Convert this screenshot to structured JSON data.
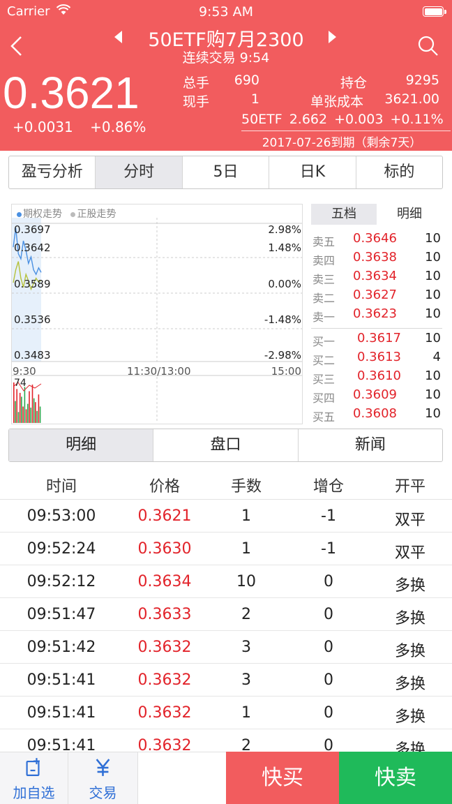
{
  "status": {
    "carrier": "Carrier",
    "time": "9:53 AM"
  },
  "header": {
    "title": "50ETF购7月2300",
    "subtitle": "连续交易 9:54",
    "price": "0.3621",
    "change": "+0.0031",
    "change_pct": "+0.86%",
    "stats": [
      {
        "label": "总手",
        "value": "690"
      },
      {
        "label": "现手",
        "value": "1"
      },
      {
        "label": "持仓",
        "value": "9295"
      },
      {
        "label": "单张成本",
        "value": "3621.00"
      }
    ],
    "etf": {
      "name": "50ETF",
      "price": "2.662",
      "change": "+0.003",
      "change_pct": "+0.11%"
    },
    "expiry": "2017-07-26到期（剩余7天）"
  },
  "tabs": [
    "盈亏分析",
    "分时",
    "5日",
    "日K",
    "标的"
  ],
  "active_tab": 1,
  "chart": {
    "legend_option": "期权走势",
    "legend_stock": "正股走势",
    "y_left": [
      "0.3697",
      "0.3642",
      "0.3589",
      "0.3536",
      "0.3483"
    ],
    "y_right": [
      "2.98%",
      "1.48%",
      "0.00%",
      "-1.48%",
      "-2.98%"
    ],
    "x_labels": [
      "9:30",
      "11:30/13:00",
      "15:00"
    ],
    "volume_max": "74"
  },
  "chart_data": {
    "type": "line",
    "ylim": [
      0.3483,
      0.3697
    ],
    "xlabel": "",
    "ylabel": "",
    "series": [
      {
        "values": [
          0.366,
          0.369,
          0.365,
          0.3642,
          0.367,
          0.3655,
          0.3635,
          0.3645,
          0.3625,
          0.3618,
          0.3628,
          0.3621
        ]
      },
      {
        "values": [
          0.3605,
          0.3625,
          0.3638,
          0.3612,
          0.3598,
          0.3618,
          0.3608,
          0.3595,
          0.3604,
          0.3612,
          0.3606,
          0.3609
        ]
      }
    ],
    "volume": [
      74,
      40,
      62,
      20,
      55,
      48,
      30,
      66,
      25,
      35,
      58,
      28,
      70,
      45,
      38,
      22,
      52,
      30
    ],
    "colors": {
      "option": "#4a90e2",
      "stock": "#b5c13a",
      "avg": "#f0b030",
      "up": "#e2232a",
      "down": "#2ca94f"
    }
  },
  "depth": {
    "tabs": [
      "五档",
      "明细"
    ],
    "sell": [
      {
        "label": "卖五",
        "price": "0.3646",
        "vol": "10"
      },
      {
        "label": "卖四",
        "price": "0.3638",
        "vol": "10"
      },
      {
        "label": "卖三",
        "price": "0.3634",
        "vol": "10"
      },
      {
        "label": "卖二",
        "price": "0.3627",
        "vol": "10"
      },
      {
        "label": "卖一",
        "price": "0.3623",
        "vol": "10"
      }
    ],
    "buy": [
      {
        "label": "买一",
        "price": "0.3617",
        "vol": "10"
      },
      {
        "label": "买二",
        "price": "0.3613",
        "vol": "4"
      },
      {
        "label": "买三",
        "price": "0.3610",
        "vol": "10"
      },
      {
        "label": "买四",
        "price": "0.3609",
        "vol": "10"
      },
      {
        "label": "买五",
        "price": "0.3608",
        "vol": "10"
      }
    ]
  },
  "tabs2": [
    "明细",
    "盘口",
    "新闻"
  ],
  "table": {
    "headers": [
      "时间",
      "价格",
      "手数",
      "增仓",
      "开平"
    ],
    "rows": [
      [
        "09:53:00",
        "0.3621",
        "1",
        "-1",
        "双平"
      ],
      [
        "09:52:24",
        "0.3630",
        "1",
        "-1",
        "双平"
      ],
      [
        "09:52:12",
        "0.3634",
        "10",
        "0",
        "多换"
      ],
      [
        "09:51:47",
        "0.3633",
        "2",
        "0",
        "多换"
      ],
      [
        "09:51:42",
        "0.3632",
        "3",
        "0",
        "多换"
      ],
      [
        "09:51:41",
        "0.3632",
        "3",
        "0",
        "多换"
      ],
      [
        "09:51:41",
        "0.3632",
        "1",
        "0",
        "多换"
      ],
      [
        "09:51:41",
        "0.3632",
        "2",
        "0",
        "多换"
      ]
    ]
  },
  "bottom": {
    "add_watch": "加自选",
    "trade": "交易",
    "quick_buy": "快买",
    "quick_sell": "快卖"
  }
}
